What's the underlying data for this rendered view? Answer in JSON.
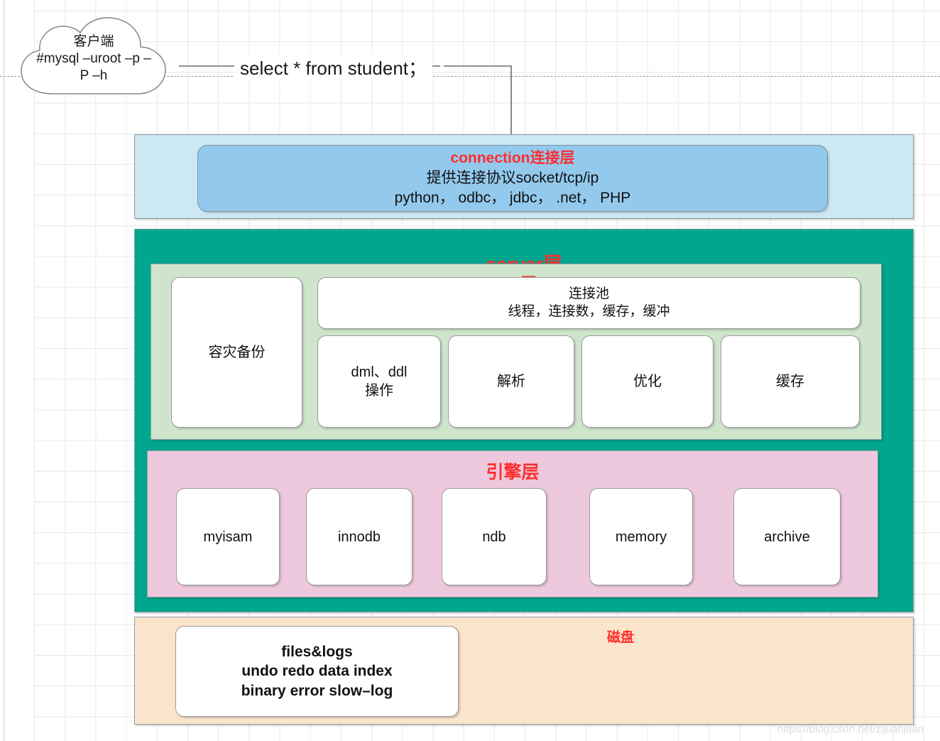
{
  "client": {
    "title": "客户端",
    "command_line1": "#mysql –uroot –p –",
    "command_line2": "P –h"
  },
  "query": {
    "label": "select * from student；"
  },
  "connection_layer": {
    "title": "connection连接层",
    "line1": "提供连接协议socket/tcp/ip",
    "line2": "python， odbc， jdbc， .net， PHP",
    "outer_color": "#cbe8f3",
    "inner_color": "#93c9ed"
  },
  "server_layer": {
    "title": "server层",
    "color": "#00a78e",
    "sql_layer": {
      "title": "sql层",
      "color": "#cee5cc",
      "disaster_recovery": "容灾备份",
      "pool": {
        "title": "连接池",
        "detail": "线程，连接数，缓存，缓冲"
      },
      "cells": [
        {
          "line1": "dml、ddl",
          "line2": "操作"
        },
        {
          "line1": "解析",
          "line2": ""
        },
        {
          "line1": "优化",
          "line2": ""
        },
        {
          "line1": "缓存",
          "line2": ""
        }
      ]
    },
    "engine_layer": {
      "title": "引擎层",
      "color": "#eec9dd",
      "engines": [
        "myisam",
        "innodb",
        "ndb",
        "memory",
        "archive"
      ]
    }
  },
  "disk_layer": {
    "title": "磁盘",
    "color": "#fae4cc",
    "files_box": {
      "line1": "files&logs",
      "line2": "undo redo data index",
      "line3": "binary error slow–log"
    }
  },
  "watermark": {
    "text": "https://blog.csdn.net/zijuanjuan"
  },
  "accent": {
    "red": "#ff2d2d",
    "stroke": "#8f9aa3"
  }
}
